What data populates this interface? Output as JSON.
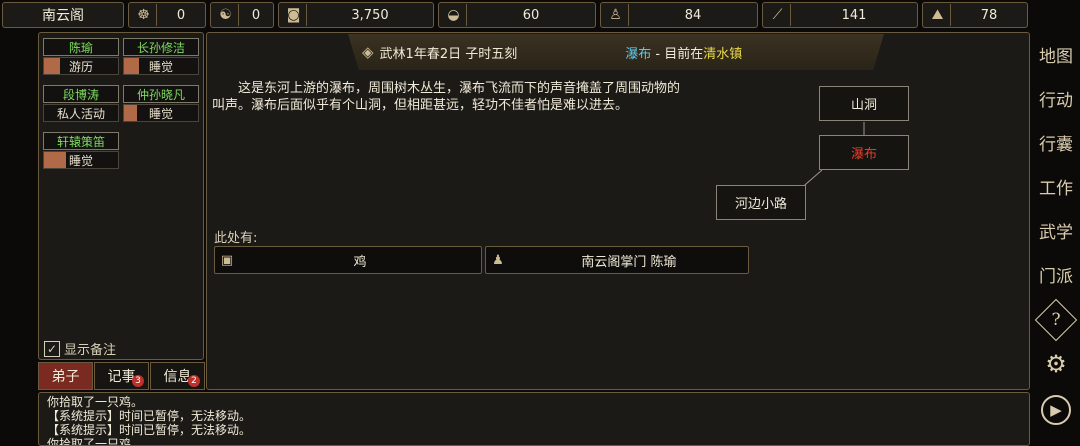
{
  "topbar": {
    "sect_name": "南云阁",
    "resources": [
      {
        "icon": "coin-pouch-icon",
        "glyph": "☸",
        "value": "0"
      },
      {
        "icon": "yinyang-icon",
        "glyph": "☯",
        "value": "0"
      },
      {
        "icon": "copper-coin-icon",
        "glyph": "◙",
        "value": "3,750"
      },
      {
        "icon": "rice-bowl-icon",
        "glyph": "◒",
        "value": "60"
      },
      {
        "icon": "gourd-icon",
        "glyph": "♙",
        "value": "84"
      },
      {
        "icon": "wood-log-icon",
        "glyph": "⟋",
        "value": "141"
      },
      {
        "icon": "ore-icon",
        "glyph": "⛰",
        "value": "78"
      }
    ]
  },
  "disciples": [
    {
      "name": "陈瑜",
      "status": "游历",
      "progress": 0.22
    },
    {
      "name": "长孙修洁",
      "status": "睡觉",
      "progress": 0.2
    },
    {
      "name": "段博涛",
      "status": "私人活动",
      "progress": 0.0
    },
    {
      "name": "仲孙晓凡",
      "status": "睡觉",
      "progress": 0.18
    },
    {
      "name": "轩辕策笛",
      "status": "睡觉",
      "progress": 0.3
    }
  ],
  "show_notes_label": "显示备注",
  "tabs": [
    {
      "label": "弟子",
      "badge": ""
    },
    {
      "label": "记事",
      "badge": "3"
    },
    {
      "label": "信息",
      "badge": "2"
    }
  ],
  "header": {
    "date": "武林1年春2日 子时五刻",
    "location": "瀑布",
    "separator": " - 目前在",
    "town": "清水镇"
  },
  "description": "这是东河上游的瀑布，周围树木丛生，瀑布飞流而下的声音掩盖了周围动物的叫声。瀑布后面似乎有个山洞，但相距甚远，轻功不佳者怕是难以进去。",
  "map_nodes": {
    "cave": "山洞",
    "waterfall": "瀑布",
    "river_path": "河边小路"
  },
  "here": {
    "label": "此处有:",
    "items": [
      {
        "icon": "crate-icon",
        "glyph": "▣",
        "label": "鸡"
      },
      {
        "icon": "person-icon",
        "glyph": "♟",
        "label": "南云阁掌门 陈瑜"
      }
    ]
  },
  "sidebar": [
    {
      "name": "map-button",
      "label": "地图"
    },
    {
      "name": "action-button",
      "label": "行动"
    },
    {
      "name": "bag-button",
      "label": "行囊"
    },
    {
      "name": "work-button",
      "label": "工作"
    },
    {
      "name": "martial-button",
      "label": "武学"
    },
    {
      "name": "sect-button",
      "label": "门派"
    },
    {
      "name": "help-button",
      "label": "?"
    },
    {
      "name": "settings-button",
      "label": "⚙"
    },
    {
      "name": "play-button",
      "label": "▶"
    }
  ],
  "log": [
    "你拾取了一只鸡。",
    "【系统提示】时间已暂停，无法移动。",
    "【系统提示】时间已暂停，无法移动。",
    "你拾取了一只鸡"
  ],
  "colors": {
    "location": "#5ec8e8",
    "town": "#e8d84a",
    "current_node": "#e83a2a",
    "disciple_name": "#7ddc5e"
  }
}
